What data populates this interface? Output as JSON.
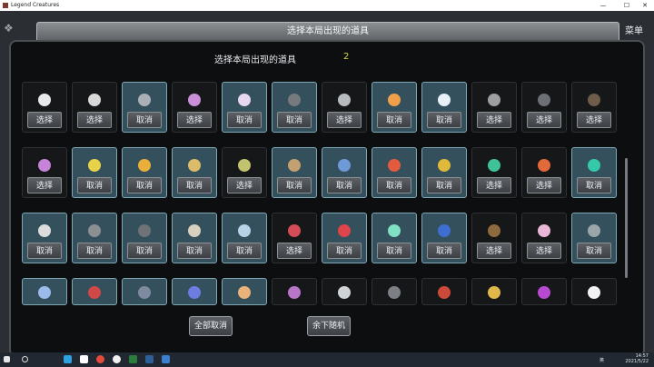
{
  "window": {
    "title": "Legend Creatures",
    "minimize_label": "—",
    "maximize_label": "☐",
    "close_label": "✕"
  },
  "game": {
    "top_bar_title": "选择本局出现的道具",
    "menu_label": "菜单"
  },
  "panel": {
    "title": "选择本局出现的道具",
    "count": "2"
  },
  "items": [
    {
      "label": "选择",
      "on": false,
      "color": "#e9e9e9"
    },
    {
      "label": "选择",
      "on": false,
      "color": "#d8d8d8"
    },
    {
      "label": "取消",
      "on": true,
      "color": "#aab0b6"
    },
    {
      "label": "选择",
      "on": false,
      "color": "#c98fd8"
    },
    {
      "label": "取消",
      "on": true,
      "color": "#e6d6ee"
    },
    {
      "label": "取消",
      "on": true,
      "color": "#777a7d"
    },
    {
      "label": "选择",
      "on": false,
      "color": "#b9bcbf"
    },
    {
      "label": "取消",
      "on": true,
      "color": "#f0a04a"
    },
    {
      "label": "取消",
      "on": true,
      "color": "#e7f1f7"
    },
    {
      "label": "选择",
      "on": false,
      "color": "#9ca0a3"
    },
    {
      "label": "选择",
      "on": false,
      "color": "#6d7074"
    },
    {
      "label": "选择",
      "on": false,
      "color": "#6f5c4a"
    },
    {
      "label": "选择",
      "on": false,
      "color": "#c783d8"
    },
    {
      "label": "取消",
      "on": true,
      "color": "#e8d348"
    },
    {
      "label": "取消",
      "on": true,
      "color": "#e8b03a"
    },
    {
      "label": "取消",
      "on": true,
      "color": "#dcbc6a"
    },
    {
      "label": "选择",
      "on": false,
      "color": "#c2c36e"
    },
    {
      "label": "取消",
      "on": true,
      "color": "#c2a072"
    },
    {
      "label": "取消",
      "on": true,
      "color": "#6f9ad8"
    },
    {
      "label": "取消",
      "on": true,
      "color": "#e25b3f"
    },
    {
      "label": "取消",
      "on": true,
      "color": "#e0b83a"
    },
    {
      "label": "选择",
      "on": false,
      "color": "#3fc29a"
    },
    {
      "label": "选择",
      "on": false,
      "color": "#e26a3a"
    },
    {
      "label": "取消",
      "on": true,
      "color": "#34c9a8"
    },
    {
      "label": "取消",
      "on": true,
      "color": "#dcdcdc"
    },
    {
      "label": "取消",
      "on": true,
      "color": "#8c8f92"
    },
    {
      "label": "取消",
      "on": true,
      "color": "#6f7276"
    },
    {
      "label": "取消",
      "on": true,
      "color": "#d8d0be"
    },
    {
      "label": "取消",
      "on": true,
      "color": "#b8d2e6"
    },
    {
      "label": "选择",
      "on": false,
      "color": "#d44c57"
    },
    {
      "label": "取消",
      "on": true,
      "color": "#e0444b"
    },
    {
      "label": "取消",
      "on": true,
      "color": "#7fe0c4"
    },
    {
      "label": "取消",
      "on": true,
      "color": "#3e6fd0"
    },
    {
      "label": "选择",
      "on": false,
      "color": "#8f6a3f"
    },
    {
      "label": "选择",
      "on": false,
      "color": "#e9b8d8"
    },
    {
      "label": "取消",
      "on": true,
      "color": "#9aa6a8"
    }
  ],
  "partial_icons": [
    {
      "color": "#9dbbe8"
    },
    {
      "color": "#d04848"
    },
    {
      "color": "#7d8aa0"
    },
    {
      "color": "#6c7ce0"
    },
    {
      "color": "#e8b27a"
    },
    {
      "color": "#b776c8"
    },
    {
      "color": "#cfd3d6"
    },
    {
      "color": "#7c8084"
    },
    {
      "color": "#cc4a3a"
    },
    {
      "color": "#e0b84a"
    },
    {
      "color": "#b74ad0"
    },
    {
      "color": "#f2f2f2"
    }
  ],
  "buttons": {
    "deselect_all": "全部取消",
    "rest_random": "余下随机"
  },
  "taskbar": {
    "time": "14:57",
    "date": "2021/5/22",
    "lang": "英"
  }
}
